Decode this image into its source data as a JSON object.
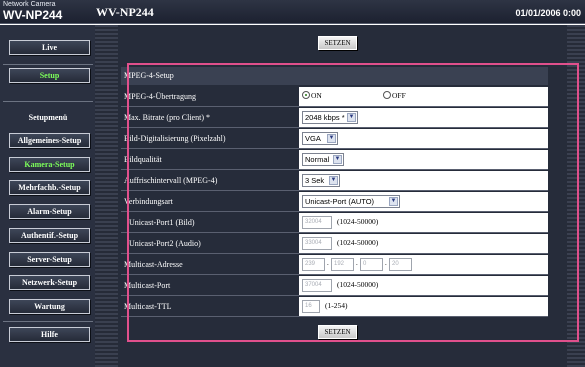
{
  "header": {
    "brand_small": "Network Camera",
    "brand_model": "WV-NP244",
    "title": "WV-NP244",
    "datetime": "01/01/2006  0:00"
  },
  "nav": {
    "live": "Live",
    "setup": "Setup",
    "menu_heading": "Setupmenü",
    "items": [
      "Allgemeines-Setup",
      "Kamera-Setup",
      "Mehrfachb.-Setup",
      "Alarm-Setup",
      "Authentif.-Setup",
      "Server-Setup",
      "Netzwerk-Setup",
      "Wartung"
    ],
    "help": "Hilfe",
    "active_item": "Kamera-Setup",
    "active_color": "#7dff5a"
  },
  "main": {
    "set_button": "SETZEN",
    "section_title": "MPEG-4-Setup",
    "rows": {
      "transfer_label": "MPEG-4-Übertragung",
      "transfer_on": "ON",
      "transfer_off": "OFF",
      "transfer_selected": "ON",
      "bitrate_label": "Max. Bitrate (pro Client) *",
      "bitrate_value": "2048 kbps *",
      "resolution_label": "Bild-Digitalisierung (Pixelzahl)",
      "resolution_value": "VGA",
      "quality_label": "Bildqualität",
      "quality_value": "Normal",
      "refresh_label": "Auffrischintervall (MPEG-4)",
      "refresh_value": "3 Sek",
      "conn_label": "Verbindungsart",
      "conn_value": "Unicast-Port (AUTO)",
      "uport1_label": "Unicast-Port1 (Bild)",
      "uport1_value": "32004",
      "uport1_hint": "(1024-50000)",
      "uport2_label": "Unicast-Port2 (Audio)",
      "uport2_value": "33004",
      "uport2_hint": "(1024-50000)",
      "maddr_label": "Multicast-Adresse",
      "maddr_1": "239",
      "maddr_2": "192",
      "maddr_3": "0",
      "maddr_4": "20",
      "mport_label": "Multicast-Port",
      "mport_value": "37004",
      "mport_hint": "(1024-50000)",
      "mttl_label": "Multicast-TTL",
      "mttl_value": "16",
      "mttl_hint": "(1-254)"
    }
  },
  "colors": {
    "highlight_border": "#e0508c",
    "panel_bg": "#262c3a"
  }
}
